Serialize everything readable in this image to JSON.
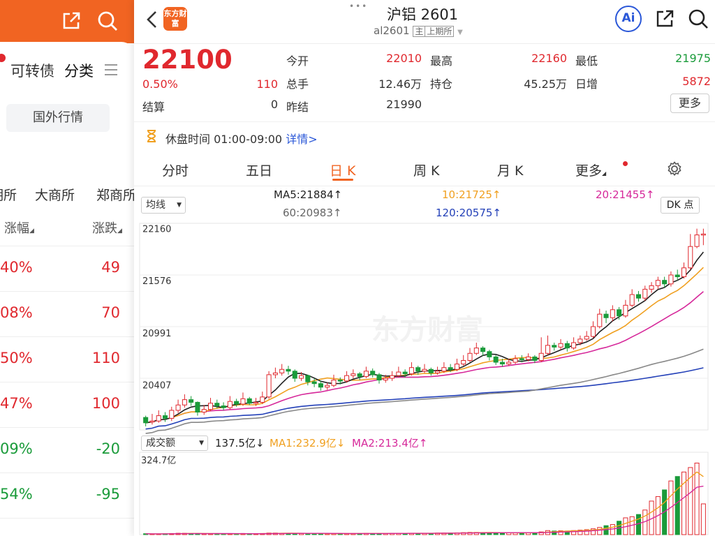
{
  "left": {
    "tabs": [
      "可转债",
      "分类"
    ],
    "section_button": "国外行情",
    "exchanges": [
      "期所",
      "大商所",
      "郑商所"
    ],
    "col1": "涨幅",
    "col2": "涨跌",
    "rows": [
      {
        "pct": "40%",
        "chg": "49",
        "dir": "up"
      },
      {
        "pct": "08%",
        "chg": "70",
        "dir": "up"
      },
      {
        "pct": "50%",
        "chg": "110",
        "dir": "up"
      },
      {
        "pct": "47%",
        "chg": "100",
        "dir": "up"
      },
      {
        "pct": "09%",
        "chg": "-20",
        "dir": "down"
      },
      {
        "pct": "54%",
        "chg": "-95",
        "dir": "down"
      }
    ]
  },
  "header": {
    "logo_text": "东方财富",
    "title": "沪铝 2601",
    "code": "al2601",
    "badge": "主",
    "exchange": "上期所",
    "ai": "Ai"
  },
  "quote": {
    "price": "22100",
    "pct": "0.50%",
    "change": "110",
    "settle_label": "结算",
    "settle": "0",
    "open_label": "今开",
    "open": "22010",
    "vol_label": "总手",
    "vol": "12.46万",
    "prev_label": "昨结",
    "prev": "21990",
    "high_label": "最高",
    "high": "22160",
    "oi_label": "持仓",
    "oi": "45.25万",
    "low_label": "最低",
    "low": "21975",
    "inc_label": "日增",
    "inc": "5872",
    "more": "更多"
  },
  "session": {
    "text": "休盘时间 01:00-09:00",
    "link": "详情"
  },
  "tabs": [
    "分时",
    "五日",
    "日 K",
    "周 K",
    "月 K",
    "更多"
  ],
  "active_tab": 2,
  "ma_select": "均线",
  "dk_button": "DK 点",
  "ma_legend": {
    "ma5": "MA5:21884",
    "ma10": "10:21725",
    "ma20": "20:21455",
    "ma60": "60:20983",
    "ma120": "120:20575"
  },
  "vol_select": "成交额",
  "vol_legend": {
    "value": "137.5亿",
    "ma1": "MA1:232.9亿",
    "ma2": "MA2:213.4亿"
  },
  "colors": {
    "up": "#e0282e",
    "down": "#1a9b3a",
    "ma5": "#222222",
    "ma10": "#f0a020",
    "ma20": "#d6289a",
    "ma60": "#888888",
    "ma120": "#2340b8",
    "brand": "#f16422",
    "ai": "#2a57d8"
  },
  "chart_data": {
    "type": "candlestick",
    "y_ticks": [
      "22160",
      "21576",
      "20991",
      "20407"
    ],
    "ylim": [
      19900,
      22220
    ],
    "vol_label": "324.7亿",
    "vol_max": 324.7,
    "candles": [
      [
        20040,
        19980,
        20060,
        19940
      ],
      [
        19990,
        20000,
        20080,
        19960
      ],
      [
        20000,
        20060,
        20120,
        19980
      ],
      [
        20060,
        20030,
        20100,
        19990
      ],
      [
        20030,
        20120,
        20160,
        20000
      ],
      [
        20120,
        20180,
        20240,
        20090
      ],
      [
        20180,
        20240,
        20300,
        20150
      ],
      [
        20240,
        20210,
        20280,
        20170
      ],
      [
        20210,
        20100,
        20220,
        20060
      ],
      [
        20100,
        20130,
        20180,
        20070
      ],
      [
        20130,
        20200,
        20260,
        20110
      ],
      [
        20200,
        20170,
        20240,
        20140
      ],
      [
        20170,
        20150,
        20210,
        20120
      ],
      [
        20150,
        20220,
        20280,
        20130
      ],
      [
        20220,
        20190,
        20250,
        20160
      ],
      [
        20190,
        20250,
        20320,
        20170
      ],
      [
        20250,
        20200,
        20270,
        20180
      ],
      [
        20200,
        20210,
        20260,
        20170
      ],
      [
        20210,
        20270,
        20330,
        20190
      ],
      [
        20270,
        20520,
        20560,
        20250
      ],
      [
        20520,
        20540,
        20600,
        20480
      ],
      [
        20540,
        20580,
        20640,
        20510
      ],
      [
        20580,
        20560,
        20620,
        20520
      ],
      [
        20560,
        20480,
        20580,
        20440
      ],
      [
        20480,
        20510,
        20550,
        20450
      ],
      [
        20510,
        20440,
        20520,
        20400
      ],
      [
        20440,
        20420,
        20480,
        20380
      ],
      [
        20420,
        20380,
        20450,
        20340
      ],
      [
        20380,
        20400,
        20430,
        20350
      ],
      [
        20400,
        20460,
        20520,
        20380
      ],
      [
        20460,
        20450,
        20490,
        20410
      ],
      [
        20450,
        20510,
        20560,
        20430
      ],
      [
        20510,
        20530,
        20580,
        20480
      ],
      [
        20530,
        20500,
        20550,
        20460
      ],
      [
        20500,
        20560,
        20610,
        20480
      ],
      [
        20560,
        20520,
        20590,
        20490
      ],
      [
        20520,
        20460,
        20540,
        20420
      ],
      [
        20460,
        20480,
        20520,
        20430
      ],
      [
        20480,
        20510,
        20560,
        20450
      ],
      [
        20510,
        20550,
        20610,
        20490
      ],
      [
        20550,
        20530,
        20580,
        20490
      ],
      [
        20530,
        20600,
        20660,
        20510
      ],
      [
        20600,
        20560,
        20620,
        20520
      ],
      [
        20560,
        20580,
        20640,
        20540
      ],
      [
        20580,
        20540,
        20600,
        20510
      ],
      [
        20540,
        20560,
        20610,
        20520
      ],
      [
        20560,
        20600,
        20660,
        20540
      ],
      [
        20600,
        20580,
        20640,
        20550
      ],
      [
        20580,
        20640,
        20700,
        20560
      ],
      [
        20640,
        20680,
        20740,
        20620
      ],
      [
        20680,
        20760,
        20820,
        20660
      ],
      [
        20760,
        20820,
        20880,
        20740
      ],
      [
        20820,
        20780,
        20840,
        20730
      ],
      [
        20780,
        20720,
        20800,
        20680
      ],
      [
        20720,
        20660,
        20740,
        20630
      ],
      [
        20660,
        20640,
        20700,
        20610
      ],
      [
        20640,
        20660,
        20700,
        20620
      ],
      [
        20660,
        20700,
        20740,
        20640
      ],
      [
        20700,
        20690,
        20740,
        20660
      ],
      [
        20690,
        20720,
        20760,
        20670
      ],
      [
        20720,
        20680,
        20740,
        20650
      ],
      [
        20680,
        20760,
        20940,
        20660
      ],
      [
        20760,
        20850,
        20960,
        20740
      ],
      [
        20850,
        20830,
        20880,
        20790
      ],
      [
        20830,
        20870,
        20920,
        20800
      ],
      [
        20870,
        20820,
        20900,
        20780
      ],
      [
        20820,
        20880,
        20940,
        20800
      ],
      [
        20880,
        20920,
        20960,
        20850
      ],
      [
        20920,
        20950,
        21010,
        20900
      ],
      [
        20950,
        21060,
        21120,
        20930
      ],
      [
        21060,
        21200,
        21260,
        21040
      ],
      [
        21200,
        21160,
        21240,
        21100
      ],
      [
        21160,
        21250,
        21300,
        21120
      ],
      [
        21250,
        21180,
        21280,
        21140
      ],
      [
        21180,
        21300,
        21360,
        21160
      ],
      [
        21300,
        21420,
        21480,
        21280
      ],
      [
        21420,
        21380,
        21460,
        21340
      ],
      [
        21380,
        21480,
        21520,
        21350
      ],
      [
        21480,
        21520,
        21560,
        21440
      ],
      [
        21520,
        21580,
        21620,
        21480
      ],
      [
        21580,
        21540,
        21620,
        21500
      ],
      [
        21540,
        21640,
        21680,
        21510
      ],
      [
        21640,
        21620,
        21700,
        21580
      ],
      [
        21620,
        21720,
        21780,
        21600
      ],
      [
        21720,
        21960,
        22100,
        21700
      ],
      [
        21960,
        22090,
        22160,
        21940
      ],
      [
        22090,
        22100,
        22160,
        21975
      ]
    ],
    "volumes": [
      4,
      3,
      3,
      4,
      5,
      6,
      6,
      5,
      5,
      4,
      4,
      4,
      3,
      4,
      4,
      5,
      4,
      4,
      5,
      7,
      7,
      6,
      6,
      6,
      5,
      5,
      5,
      5,
      4,
      5,
      5,
      5,
      5,
      5,
      6,
      5,
      5,
      5,
      6,
      6,
      6,
      6,
      6,
      6,
      6,
      7,
      7,
      7,
      8,
      9,
      10,
      10,
      9,
      9,
      8,
      8,
      8,
      8,
      8,
      9,
      9,
      12,
      18,
      16,
      17,
      16,
      18,
      20,
      22,
      26,
      32,
      40,
      45,
      60,
      75,
      80,
      90,
      110,
      150,
      170,
      200,
      240,
      260,
      280,
      300,
      320,
      137.5
    ]
  }
}
